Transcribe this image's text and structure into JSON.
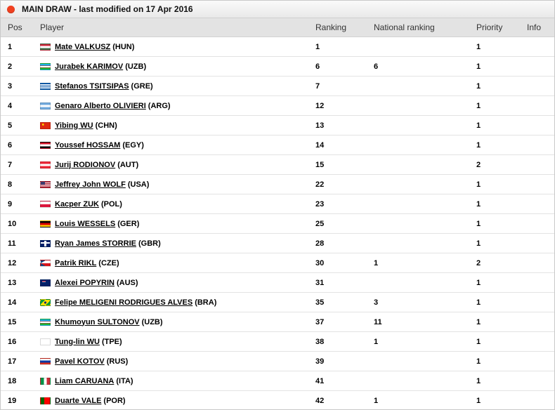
{
  "header": {
    "title": "MAIN DRAW - last modified on 17 Apr 2016"
  },
  "columns": {
    "pos": "Pos",
    "player": "Player",
    "ranking": "Ranking",
    "national": "National ranking",
    "priority": "Priority",
    "info": "Info"
  },
  "players": [
    {
      "pos": "1",
      "name": "Mate VALKUSZ",
      "country": "(HUN)",
      "ranking": "1",
      "national": "",
      "priority": "1"
    },
    {
      "pos": "2",
      "name": "Jurabek KARIMOV",
      "country": "(UZB)",
      "ranking": "6",
      "national": "6",
      "priority": "1"
    },
    {
      "pos": "3",
      "name": "Stefanos TSITSIPAS",
      "country": "(GRE)",
      "ranking": "7",
      "national": "",
      "priority": "1"
    },
    {
      "pos": "4",
      "name": "Genaro Alberto OLIVIERI",
      "country": "(ARG)",
      "ranking": "12",
      "national": "",
      "priority": "1"
    },
    {
      "pos": "5",
      "name": "Yibing WU",
      "country": "(CHN)",
      "ranking": "13",
      "national": "",
      "priority": "1"
    },
    {
      "pos": "6",
      "name": "Youssef HOSSAM",
      "country": "(EGY)",
      "ranking": "14",
      "national": "",
      "priority": "1"
    },
    {
      "pos": "7",
      "name": "Jurij RODIONOV",
      "country": "(AUT)",
      "ranking": "15",
      "national": "",
      "priority": "2"
    },
    {
      "pos": "8",
      "name": "Jeffrey John WOLF",
      "country": "(USA)",
      "ranking": "22",
      "national": "",
      "priority": "1"
    },
    {
      "pos": "9",
      "name": "Kacper ZUK",
      "country": "(POL)",
      "ranking": "23",
      "national": "",
      "priority": "1"
    },
    {
      "pos": "10",
      "name": "Louis WESSELS",
      "country": "(GER)",
      "ranking": "25",
      "national": "",
      "priority": "1"
    },
    {
      "pos": "11",
      "name": "Ryan James STORRIE",
      "country": "(GBR)",
      "ranking": "28",
      "national": "",
      "priority": "1"
    },
    {
      "pos": "12",
      "name": "Patrik RIKL",
      "country": "(CZE)",
      "ranking": "30",
      "national": "1",
      "priority": "2"
    },
    {
      "pos": "13",
      "name": "Alexei POPYRIN",
      "country": "(AUS)",
      "ranking": "31",
      "national": "",
      "priority": "1"
    },
    {
      "pos": "14",
      "name": "Felipe MELIGENI RODRIGUES ALVES",
      "country": "(BRA)",
      "ranking": "35",
      "national": "3",
      "priority": "1"
    },
    {
      "pos": "15",
      "name": "Khumoyun SULTONOV",
      "country": "(UZB)",
      "ranking": "37",
      "national": "11",
      "priority": "1"
    },
    {
      "pos": "16",
      "name": "Tung-lin WU",
      "country": "(TPE)",
      "ranking": "38",
      "national": "1",
      "priority": "1"
    },
    {
      "pos": "17",
      "name": "Pavel KOTOV",
      "country": "(RUS)",
      "ranking": "39",
      "national": "",
      "priority": "1"
    },
    {
      "pos": "18",
      "name": "Liam CARUANA",
      "country": "(ITA)",
      "ranking": "41",
      "national": "",
      "priority": "1"
    },
    {
      "pos": "19",
      "name": "Duarte VALE",
      "country": "(POR)",
      "ranking": "42",
      "national": "1",
      "priority": "1"
    }
  ]
}
